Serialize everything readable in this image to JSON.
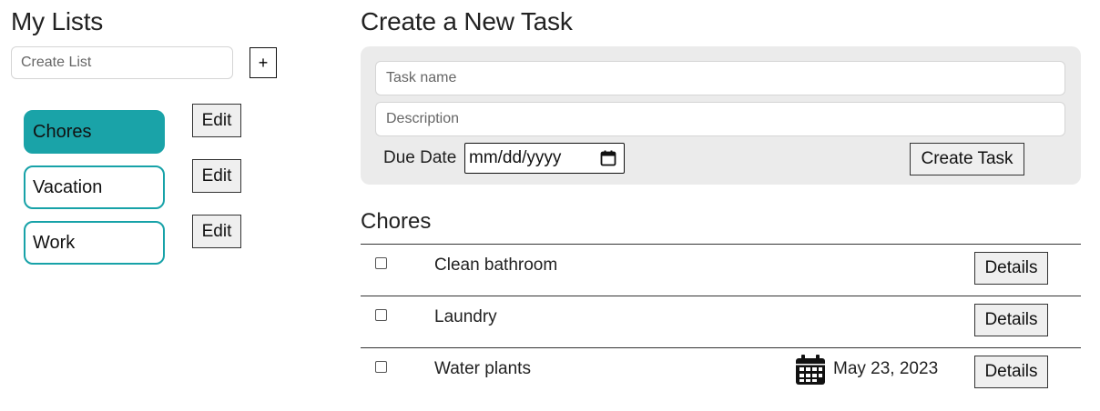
{
  "sidebar": {
    "title": "My Lists",
    "create_placeholder": "Create List",
    "add_label": "+",
    "edit_label": "Edit",
    "lists": [
      {
        "name": "Chores",
        "active": true
      },
      {
        "name": "Vacation",
        "active": false
      },
      {
        "name": "Work",
        "active": false
      }
    ]
  },
  "task_form": {
    "title": "Create a New Task",
    "name_placeholder": "Task name",
    "description_placeholder": "Description",
    "due_label": "Due Date",
    "date_placeholder": "mm/dd/yyyy",
    "submit_label": "Create Task"
  },
  "task_list": {
    "title": "Chores",
    "details_label": "Details",
    "tasks": [
      {
        "name": "Clean bathroom",
        "due": ""
      },
      {
        "name": "Laundry",
        "due": ""
      },
      {
        "name": "Water plants",
        "due": "May 23, 2023"
      }
    ]
  },
  "colors": {
    "accent": "#1aa3a8",
    "form_bg": "#ebebeb"
  },
  "icons": {
    "due_date": "calendar-icon"
  }
}
